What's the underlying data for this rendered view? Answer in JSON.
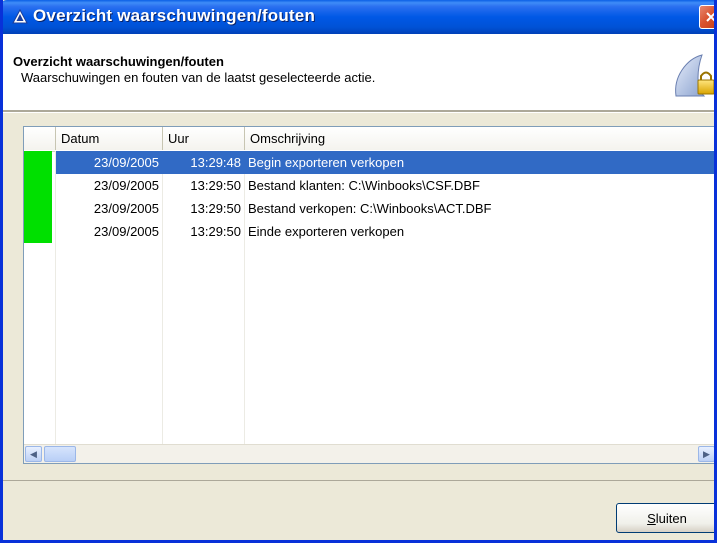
{
  "window": {
    "title": "Overzicht waarschuwingen/fouten"
  },
  "header": {
    "title": "Overzicht waarschuwingen/fouten",
    "subtitle": "Waarschuwingen en fouten van de laatst geselecteerde actie."
  },
  "list": {
    "columns": [
      "",
      "Datum",
      "Uur",
      "Omschrijving"
    ],
    "rows": [
      {
        "status_color": "#00e000",
        "datum": "23/09/2005",
        "uur": "13:29:48",
        "omschrijving": "Begin exporteren verkopen",
        "selected": true
      },
      {
        "status_color": "#00e000",
        "datum": "23/09/2005",
        "uur": "13:29:50",
        "omschrijving": "Bestand klanten: C:\\Winbooks\\CSF.DBF",
        "selected": false
      },
      {
        "status_color": "#00e000",
        "datum": "23/09/2005",
        "uur": "13:29:50",
        "omschrijving": "Bestand verkopen: C:\\Winbooks\\ACT.DBF",
        "selected": false
      },
      {
        "status_color": "#00e000",
        "datum": "23/09/2005",
        "uur": "13:29:50",
        "omschrijving": "Einde exporteren verkopen",
        "selected": false
      }
    ]
  },
  "footer": {
    "close_button": {
      "access_key": "S",
      "rest": "luiten"
    }
  },
  "colors": {
    "titlebar": "#0058e6",
    "selection": "#316ac5",
    "status_ok": "#00e000"
  }
}
